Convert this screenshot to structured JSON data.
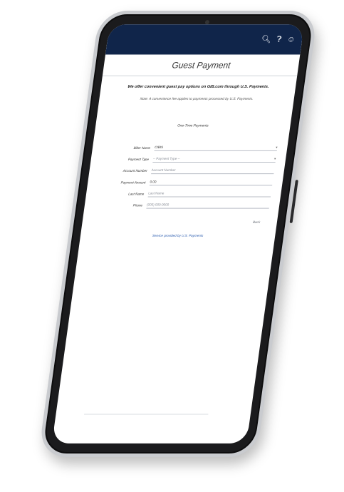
{
  "header": {
    "title": "Guest Payment",
    "icons": [
      "search-icon",
      "help-icon",
      "user-icon"
    ]
  },
  "intro": {
    "text": "We offer convenient guest pay options on GIB.com through U.S. Payments.",
    "note": "Note: A convenience fee applies to payments processed by U.S. Payments."
  },
  "section": {
    "title": "One-Time Payments"
  },
  "form": {
    "biller_label": "Biller Name",
    "biller_value": "CIBIS",
    "payment_type_label": "Payment Type",
    "payment_type_placeholder": "-- Payment Type --",
    "account_label": "Account Number",
    "account_placeholder": "Account Number",
    "amount_label": "Payment Amount",
    "amount_value": "0.00",
    "last_name_label": "Last Name",
    "last_name_placeholder": "Last Name",
    "phone_label": "Phone",
    "phone_placeholder": "(000) 000-0000"
  },
  "actions": {
    "back_label": "Back"
  },
  "footer": {
    "link": "Service provided by U.S. Payments"
  },
  "colors": {
    "topbar": "#10254a",
    "link": "#2f5fb0"
  }
}
